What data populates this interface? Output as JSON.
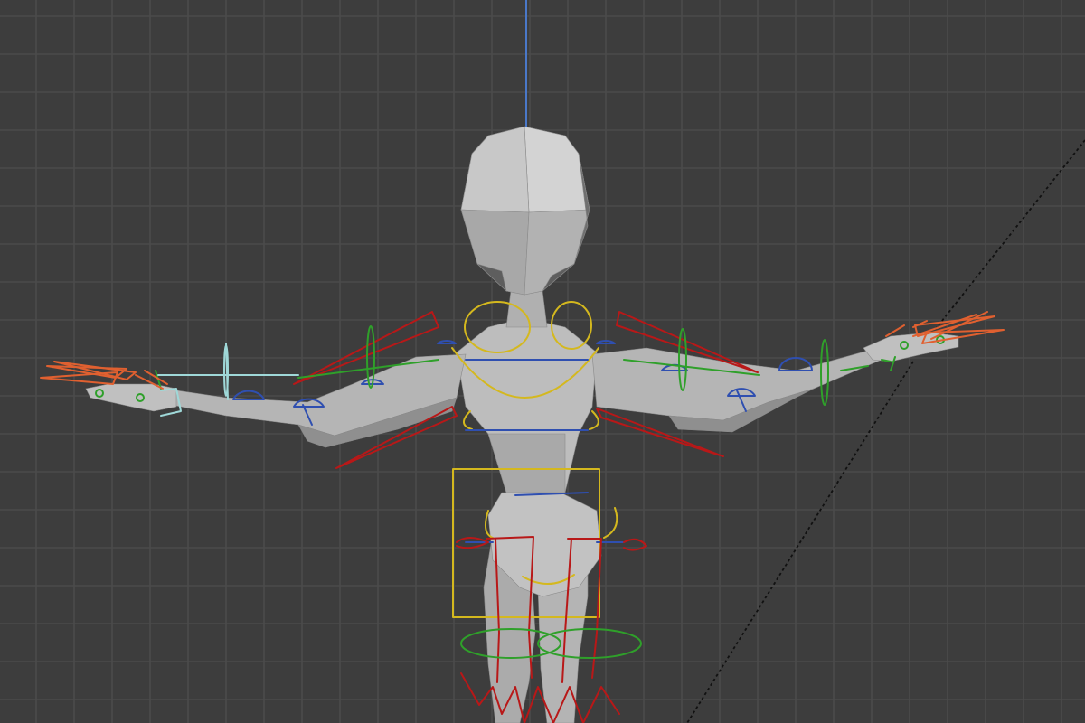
{
  "viewport": {
    "mode": "3D Viewport",
    "object": "armature-rig",
    "colors": {
      "background": "#3d3d3d",
      "grid": "#4b4b4b",
      "mesh": "#b8b8b8",
      "z_axis": "#4a78c8",
      "fk_bones": "#2f4fb0",
      "ik_bones": "#b81818",
      "torso_bones": "#d4b81e",
      "tweak_bones": "#2fa02a",
      "finger_bones": "#e06030",
      "selected_bone": "#9fd8d8"
    },
    "icons": [
      "armature-icon",
      "mesh-icon",
      "camera-icon"
    ]
  }
}
